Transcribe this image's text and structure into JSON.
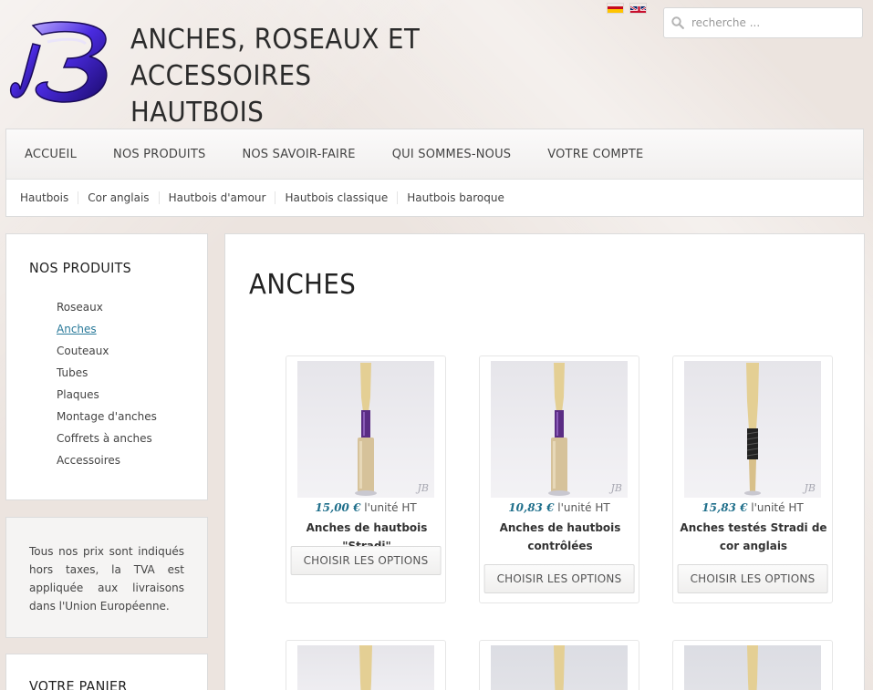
{
  "header": {
    "title_line1": "ANCHES, ROSEAUX ET ACCESSOIRES",
    "title_line2": "HAUTBOIS",
    "logo_icon": "jb-logo-icon",
    "flags": [
      "spanish-flag-icon",
      "english-flag-icon"
    ],
    "search": {
      "placeholder": "recherche ...",
      "value": ""
    }
  },
  "nav": {
    "main": [
      "ACCUEIL",
      "NOS PRODUITS",
      "NOS SAVOIR-FAIRE",
      "QUI SOMMES-NOUS",
      "VOTRE COMPTE"
    ],
    "sub": [
      "Hautbois",
      "Cor anglais",
      "Hautbois d'amour",
      "Hautbois classique",
      "Hautbois baroque"
    ]
  },
  "sidebar": {
    "products_title": "NOS PRODUITS",
    "categories": [
      "Roseaux",
      "Anches",
      "Couteaux",
      "Tubes",
      "Plaques",
      "Montage d'anches",
      "Coffrets à anches",
      "Accessoires"
    ],
    "active_category": "Anches",
    "tax_note": "Tous nos prix sont indiqués hors taxes, la TVA est appliquée aux livraisons dans l'Union Européenne.",
    "cart_title": "VOTRE PANIER"
  },
  "content": {
    "page_title": "ANCHES",
    "products": [
      {
        "price": "15,00 €",
        "unit": " l'unité HT",
        "name": "Anches de hautbois \"Stradi\"",
        "button": "CHOISIR LES OPTIONS"
      },
      {
        "price": "10,83 €",
        "unit": " l'unité HT",
        "name": "Anches de hautbois contrôlées",
        "button": "CHOISIR LES OPTIONS"
      },
      {
        "price": "15,83 €",
        "unit": " l'unité HT",
        "name": "Anches testés Stradi de cor anglais",
        "button": "CHOISIR LES OPTIONS"
      }
    ],
    "watermark": "JB"
  },
  "colors": {
    "accent": "#1f6f8b",
    "logo": "#4a2be0",
    "background": "#ece4df"
  }
}
